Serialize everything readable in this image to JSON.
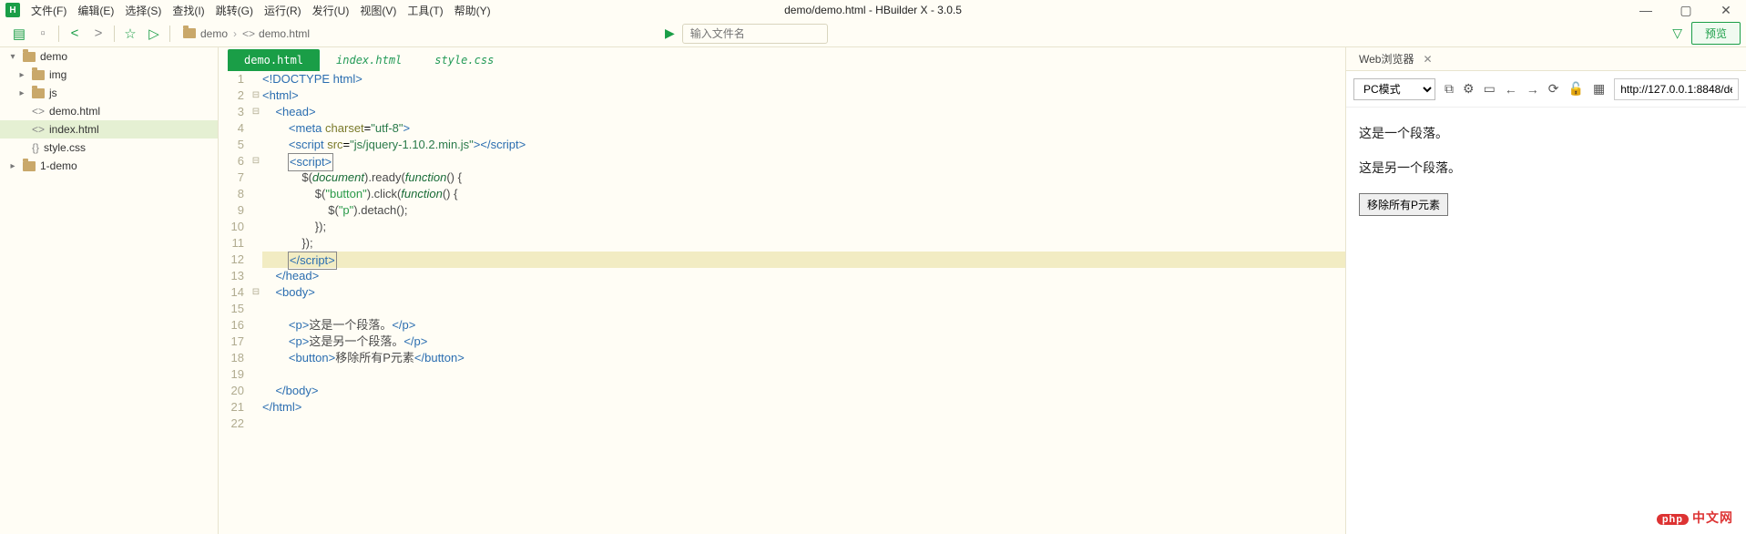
{
  "app": {
    "title": "demo/demo.html - HBuilder X - 3.0.5",
    "logo": "H"
  },
  "menu": [
    "文件(F)",
    "编辑(E)",
    "选择(S)",
    "查找(I)",
    "跳转(G)",
    "运行(R)",
    "发行(U)",
    "视图(V)",
    "工具(T)",
    "帮助(Y)"
  ],
  "toolbar": {
    "breadcrumb": [
      "demo",
      "demo.html"
    ],
    "search_placeholder": "输入文件名",
    "preview_btn": "预览"
  },
  "tree": [
    {
      "depth": 0,
      "chev": "▾",
      "type": "folder",
      "label": "demo"
    },
    {
      "depth": 1,
      "chev": "▸",
      "type": "folder",
      "label": "img"
    },
    {
      "depth": 1,
      "chev": "▸",
      "type": "folder",
      "label": "js"
    },
    {
      "depth": 1,
      "chev": "",
      "type": "file",
      "icon": "<>",
      "label": "demo.html"
    },
    {
      "depth": 1,
      "chev": "",
      "type": "file",
      "icon": "<>",
      "label": "index.html",
      "sel": true
    },
    {
      "depth": 1,
      "chev": "",
      "type": "file",
      "icon": "{}",
      "label": "style.css"
    },
    {
      "depth": 0,
      "chev": "▸",
      "type": "folder",
      "label": "1-demo"
    }
  ],
  "editor": {
    "tabs": [
      {
        "label": "demo.html",
        "active": true
      },
      {
        "label": "index.html",
        "active": false
      },
      {
        "label": "style.css",
        "active": false
      }
    ],
    "active_line": 12,
    "file": "demo.html",
    "lines": [
      {
        "n": 1,
        "fold": "",
        "html": "<span class='t-tag'>&lt;!DOCTYPE html&gt;</span>"
      },
      {
        "n": 2,
        "fold": "⊟",
        "html": "<span class='t-tag'>&lt;html&gt;</span>"
      },
      {
        "n": 3,
        "fold": "⊟",
        "html": "    <span class='t-tag'>&lt;head&gt;</span>"
      },
      {
        "n": 4,
        "fold": "",
        "html": "        <span class='t-tag'>&lt;meta</span> <span class='t-attr'>charset</span>=<span class='t-str'>\"utf-8\"</span><span class='t-tag'>&gt;</span>"
      },
      {
        "n": 5,
        "fold": "",
        "html": "        <span class='t-tag'>&lt;script</span> <span class='t-attr'>src</span>=<span class='t-str'>\"js/jquery-1.10.2.min.js\"</span><span class='t-tag'>&gt;&lt;/script&gt;</span>"
      },
      {
        "n": 6,
        "fold": "⊟",
        "html": "        <span class='cursor-box'><span class='t-tag'>&lt;script&gt;</span></span>"
      },
      {
        "n": 7,
        "fold": "",
        "html": "            <span class='t-js'>$(</span><span class='t-var'>document</span><span class='t-js'>).ready(</span><span class='t-fn'>function</span><span class='t-js'>() {</span>"
      },
      {
        "n": 8,
        "fold": "",
        "html": "                <span class='t-js'>$(</span><span class='t-jstr'>\"button\"</span><span class='t-js'>).click(</span><span class='t-fn'>function</span><span class='t-js'>() {</span>"
      },
      {
        "n": 9,
        "fold": "",
        "html": "                    <span class='t-js'>$(</span><span class='t-jstr'>\"p\"</span><span class='t-js'>).detach();</span>"
      },
      {
        "n": 10,
        "fold": "",
        "html": "                <span class='t-js'>});</span>"
      },
      {
        "n": 11,
        "fold": "",
        "html": "            <span class='t-js'>});</span>"
      },
      {
        "n": 12,
        "fold": "",
        "hl": true,
        "html": "        <span class='cursor-box'><span class='t-tag'>&lt;/script&gt;</span></span>"
      },
      {
        "n": 13,
        "fold": "",
        "html": "    <span class='t-tag'>&lt;/head&gt;</span>"
      },
      {
        "n": 14,
        "fold": "⊟",
        "html": "    <span class='t-tag'>&lt;body&gt;</span>"
      },
      {
        "n": 15,
        "fold": "",
        "html": ""
      },
      {
        "n": 16,
        "fold": "",
        "html": "        <span class='t-tag'>&lt;p&gt;</span><span class='t-text'>这是一个段落。</span><span class='t-tag'>&lt;/p&gt;</span>"
      },
      {
        "n": 17,
        "fold": "",
        "html": "        <span class='t-tag'>&lt;p&gt;</span><span class='t-text'>这是另一个段落。</span><span class='t-tag'>&lt;/p&gt;</span>"
      },
      {
        "n": 18,
        "fold": "",
        "html": "        <span class='t-tag'>&lt;button&gt;</span><span class='t-text'>移除所有P元素</span><span class='t-tag'>&lt;/button&gt;</span>"
      },
      {
        "n": 19,
        "fold": "",
        "html": ""
      },
      {
        "n": 20,
        "fold": "",
        "html": "    <span class='t-tag'>&lt;/body&gt;</span>"
      },
      {
        "n": 21,
        "fold": "",
        "html": "<span class='t-tag'>&lt;/html&gt;</span>"
      },
      {
        "n": 22,
        "fold": "",
        "html": ""
      }
    ]
  },
  "preview": {
    "tab_label": "Web浏览器",
    "mode_select": "PC模式",
    "url": "http://127.0.0.1:8848/de",
    "p1": "这是一个段落。",
    "p2": "这是另一个段落。",
    "button_label": "移除所有P元素"
  },
  "watermark": {
    "badge": "php",
    "text": "中文网"
  }
}
